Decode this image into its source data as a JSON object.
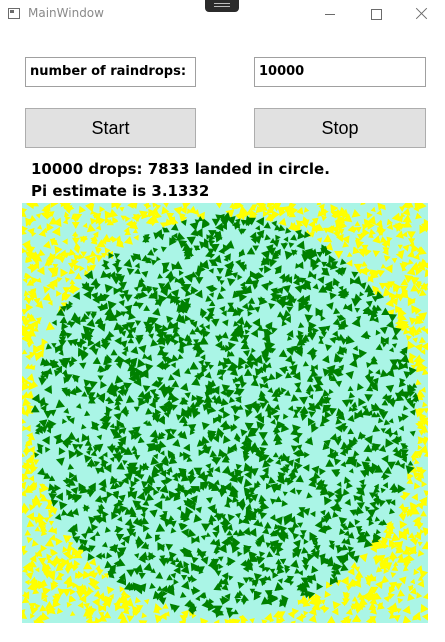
{
  "window": {
    "title": "MainWindow"
  },
  "inputs": {
    "drops_label": "number of raindrops:",
    "drops_count": "10000"
  },
  "buttons": {
    "start_label": "Start",
    "stop_label": "Stop"
  },
  "status": {
    "line1": "10000 drops: 7833 landed in circle.",
    "line2": "Pi estimate is 3.1332"
  },
  "simulation": {
    "total_drops": 10000,
    "inside_circle": 7833,
    "pi_estimate": 3.1332
  },
  "colors": {
    "square_background": "#aaf5e6",
    "outside_drop": "#ffff00",
    "inside_drop": "#008000"
  },
  "icons": {
    "app": "app-window-icon",
    "minimize": "minimize-icon",
    "maximize": "maximize-icon",
    "close": "close-icon"
  }
}
